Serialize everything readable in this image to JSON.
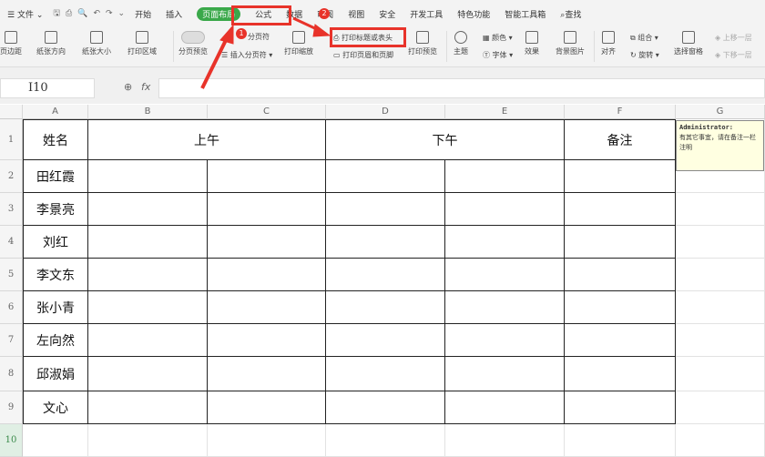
{
  "menu": {
    "file": "文件",
    "tabs": [
      "开始",
      "插入",
      "页面布局",
      "公式",
      "数据",
      "审阅",
      "视图",
      "安全",
      "开发工具",
      "特色功能",
      "智能工具箱"
    ],
    "search": "查找"
  },
  "ribbon": {
    "margins": "页边距",
    "orientation": "纸张方向",
    "size": "纸张大小",
    "print_area": "打印区域",
    "page_preview": "分页预览",
    "page_break": "分页符",
    "insert_break": "插入分页符",
    "print_scale": "打印缩放",
    "print_titles": "打印标题或表头",
    "header_footer": "打印页眉和页脚",
    "print_preview": "打印预览",
    "theme": "主题",
    "color": "颜色",
    "font": "字体",
    "effect": "效果",
    "bg_image": "背景图片",
    "align": "对齐",
    "group": "组合",
    "rotate": "旋转",
    "selection_pane": "选择窗格",
    "bring_forward": "上移一层",
    "send_backward": "下移一层"
  },
  "formula": {
    "namebox": "I10",
    "fx": "fx",
    "value": ""
  },
  "columns": [
    "A",
    "B",
    "C",
    "D",
    "E",
    "F",
    "G"
  ],
  "rows": [
    "1",
    "2",
    "3",
    "4",
    "5",
    "6",
    "7",
    "8",
    "9",
    "10"
  ],
  "table": {
    "h_name": "姓名",
    "h_am": "上午",
    "h_pm": "下午",
    "h_note": "备注",
    "names": [
      "田红霞",
      "李景亮",
      "刘红",
      "李文东",
      "张小青",
      "左向然",
      "邱淑娟",
      "文心"
    ]
  },
  "comment": {
    "author": "Administrator:",
    "text": "有其它事宜，请在备注一栏注明"
  },
  "badges": [
    "1",
    "2"
  ],
  "accent": "#3aa84a",
  "annotation_color": "#e8332a"
}
